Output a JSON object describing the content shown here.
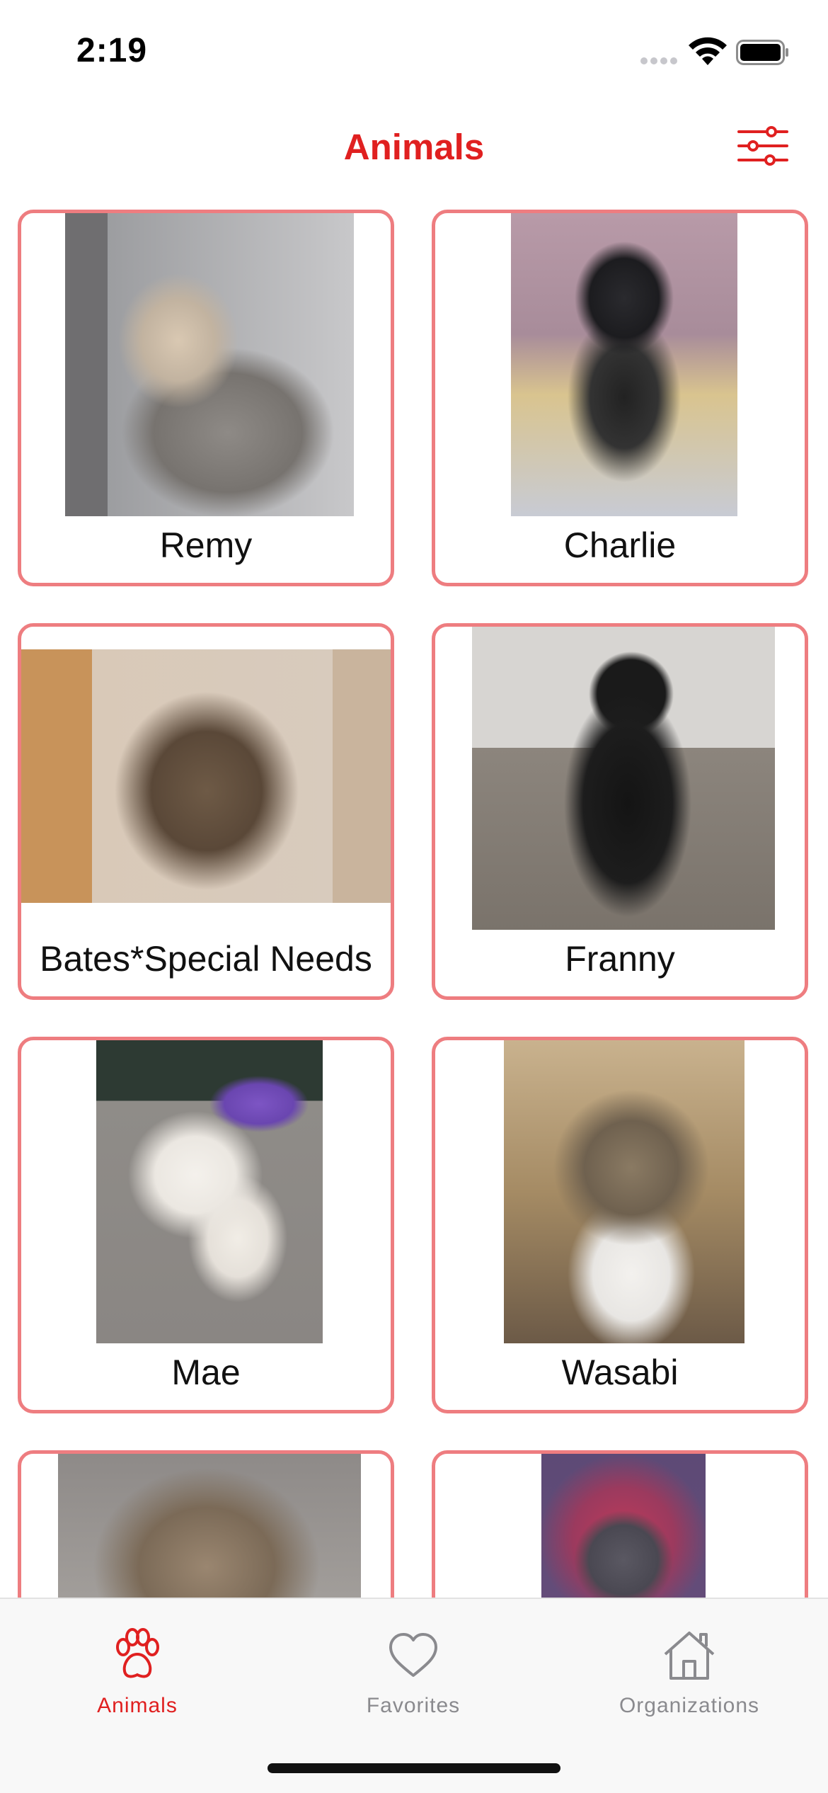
{
  "status_bar": {
    "time": "2:19"
  },
  "nav": {
    "title": "Animals",
    "accent_color": "#e02020",
    "filter_icon": "sliders-icon"
  },
  "animals": [
    {
      "name": "Remy",
      "photo": "gray-calico-cat-photo"
    },
    {
      "name": "Charlie",
      "photo": "black-tan-chihuahua-photo"
    },
    {
      "name": "Bates*Special Needs",
      "photo": "tabby-cat-photo"
    },
    {
      "name": "Franny",
      "photo": "black-cat-photo"
    },
    {
      "name": "Mae",
      "photo": "white-calico-cat-photo"
    },
    {
      "name": "Wasabi",
      "photo": "tabby-white-cat-photo"
    },
    {
      "name": "",
      "photo": "tabby-kitten-closeup-photo"
    },
    {
      "name": "",
      "photo": "gray-cat-pink-background-photo"
    }
  ],
  "tab_bar": {
    "tabs": [
      {
        "label": "Animals",
        "icon": "paw-icon",
        "selected": true
      },
      {
        "label": "Favorites",
        "icon": "heart-icon",
        "selected": false
      },
      {
        "label": "Organizations",
        "icon": "house-icon",
        "selected": false
      }
    ],
    "selected_color": "#e02020",
    "unselected_color": "#8a8a8e"
  },
  "colors": {
    "card_border": "#ee7d80"
  }
}
